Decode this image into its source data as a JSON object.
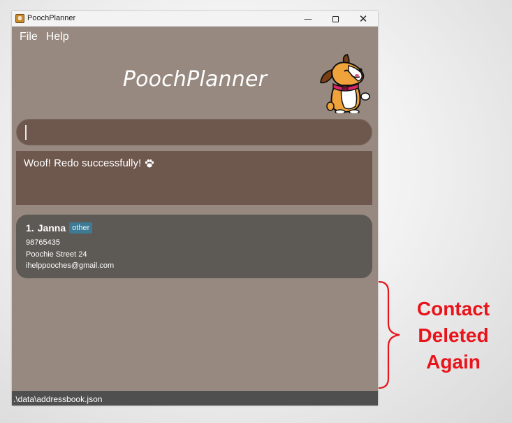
{
  "window": {
    "title": "PoochPlanner",
    "minimize": "—",
    "close": "✕"
  },
  "menu": {
    "file": "File",
    "help": "Help"
  },
  "header": {
    "app_title": "PoochPlanner",
    "logo_icon": "dog-mascot-icon"
  },
  "command_box": {
    "value": "",
    "placeholder": ""
  },
  "result": {
    "message": "Woof! Redo successfully!",
    "icon": "paw-icon"
  },
  "contacts": [
    {
      "index": "1.",
      "name": "Janna",
      "tag": "other",
      "phone": "98765435",
      "address": "Poochie Street 24",
      "email": "ihelppooches@gmail.com"
    }
  ],
  "status_bar": {
    "path": ".\\data\\addressbook.json"
  },
  "annotation": {
    "lines": [
      "Contact",
      "Deleted",
      "Again"
    ],
    "color": "#e8141b"
  },
  "colors": {
    "window_bg": "#978980",
    "input_bg": "#6e574c",
    "card_bg": "#5d5954",
    "tag_bg": "#3e7a93",
    "status_bg": "#4f4f4f"
  }
}
